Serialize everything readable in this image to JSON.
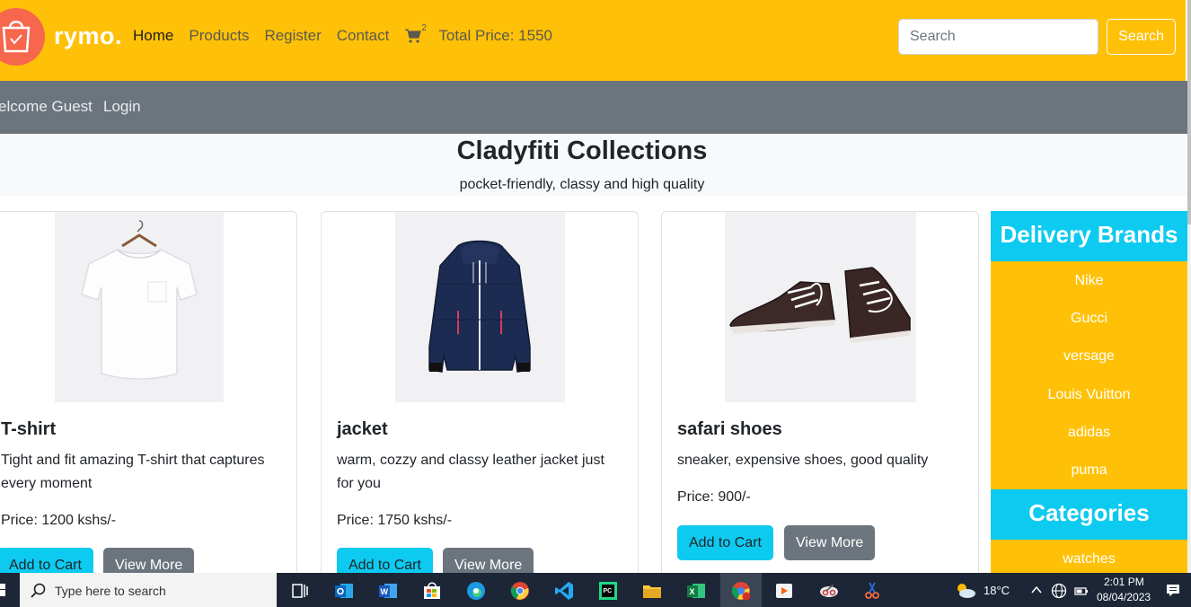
{
  "navbar": {
    "brand": "rymo.",
    "links": [
      "Home",
      "Products",
      "Register",
      "Contact"
    ],
    "cart_count": "2",
    "total_price": "Total Price: 1550",
    "search_placeholder": "Search",
    "search_button": "Search"
  },
  "subnav": {
    "welcome": "elcome Guest",
    "login": "Login"
  },
  "hero": {
    "title": "Cladyfiti Collections",
    "subtitle": "pocket-friendly, classy and high quality"
  },
  "products": [
    {
      "name": "T-shirt",
      "description": "Tight and fit amazing T-shirt that captures every moment",
      "price": "Price: 1200 kshs/-",
      "add_label": "Add to Cart",
      "more_label": "View More"
    },
    {
      "name": "jacket",
      "description": "warm, cozzy and classy leather jacket just for you",
      "price": "Price: 1750 kshs/-",
      "add_label": "Add to Cart",
      "more_label": "View More"
    },
    {
      "name": "safari shoes",
      "description": "sneaker, expensive shoes, good quality",
      "price": "Price: 900/-",
      "add_label": "Add to Cart",
      "more_label": "View More"
    }
  ],
  "sidebar": {
    "brands_title": "Delivery Brands",
    "brands": [
      "Nike",
      "Gucci",
      "versage",
      "Louis Vuitton",
      "adidas",
      "puma"
    ],
    "categories_title": "Categories",
    "categories": [
      "watches"
    ]
  },
  "taskbar": {
    "search_placeholder": "Type here to search",
    "temperature": "18°C",
    "time": "2:01 PM",
    "date": "08/04/2023"
  },
  "colors": {
    "navbar": "#ffc107",
    "subnav": "#6c757d",
    "accent": "#0dcaf0",
    "logo": "#f7674d"
  }
}
